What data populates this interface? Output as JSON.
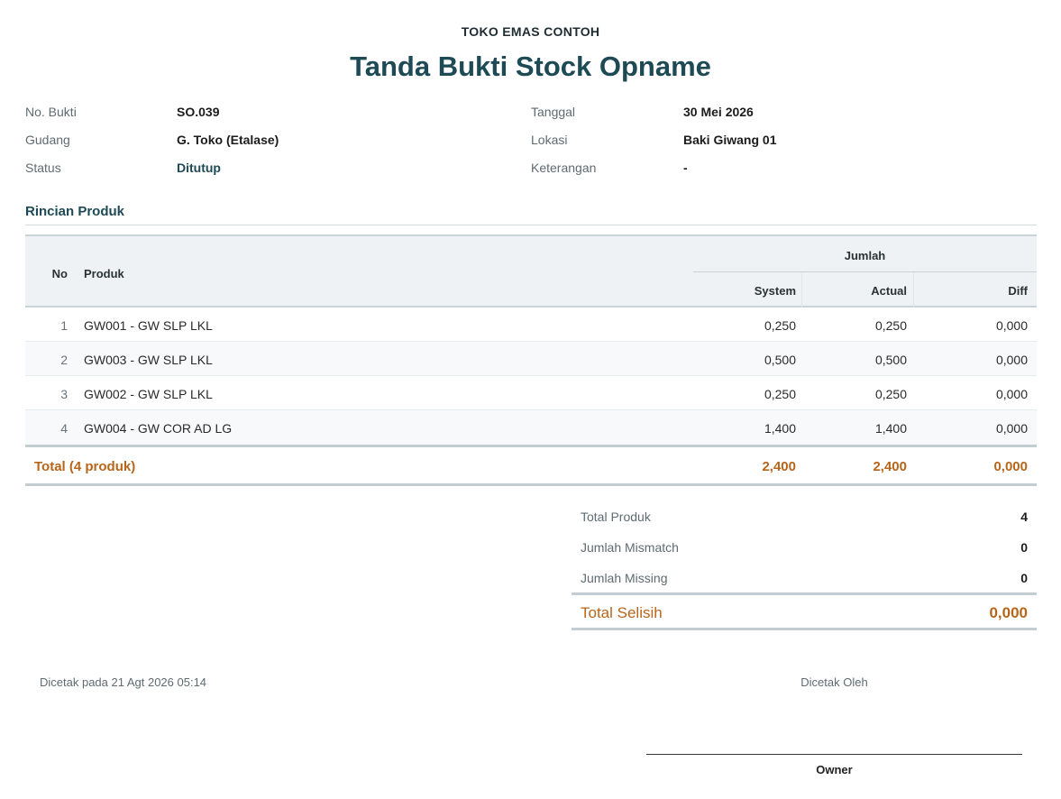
{
  "header": {
    "store_name": "TOKO EMAS CONTOH",
    "title": "Tanda Bukti Stock Opname"
  },
  "info": {
    "no_bukti_label": "No. Bukti",
    "no_bukti": "SO.039",
    "tanggal_label": "Tanggal",
    "tanggal": "30 Mei 2026",
    "gudang_label": "Gudang",
    "gudang": "G. Toko (Etalase)",
    "lokasi_label": "Lokasi",
    "lokasi": "Baki Giwang 01",
    "status_label": "Status",
    "status": "Ditutup",
    "keterangan_label": "Keterangan",
    "keterangan": "-"
  },
  "section_title": "Rincian Produk",
  "table": {
    "headers": {
      "no": "No",
      "produk": "Produk",
      "jumlah": "Jumlah",
      "system": "System",
      "actual": "Actual",
      "diff": "Diff"
    },
    "rows": [
      {
        "no": "1",
        "produk": "GW001 - GW SLP LKL",
        "system": "0,250",
        "actual": "0,250",
        "diff": "0,000"
      },
      {
        "no": "2",
        "produk": "GW003 - GW SLP LKL",
        "system": "0,500",
        "actual": "0,500",
        "diff": "0,000"
      },
      {
        "no": "3",
        "produk": "GW002 - GW SLP LKL",
        "system": "0,250",
        "actual": "0,250",
        "diff": "0,000"
      },
      {
        "no": "4",
        "produk": "GW004 - GW COR AD LG",
        "system": "1,400",
        "actual": "1,400",
        "diff": "0,000"
      }
    ],
    "total": {
      "label": "Total (4 produk)",
      "system": "2,400",
      "actual": "2,400",
      "diff": "0,000"
    }
  },
  "summary": {
    "total_produk_label": "Total Produk",
    "total_produk": "4",
    "mismatch_label": "Jumlah Mismatch",
    "mismatch": "0",
    "missing_label": "Jumlah Missing",
    "missing": "0",
    "total_selisih_label": "Total Selisih",
    "total_selisih": "0,000"
  },
  "footer": {
    "printed_at": "Dicetak pada 21 Agt 2026 05:14",
    "printed_by_label": "Dicetak Oleh",
    "signer": "Owner"
  },
  "colors": {
    "title": "#1d4a55",
    "accent": "#b7651a",
    "header_bg": "#eef2f4"
  }
}
